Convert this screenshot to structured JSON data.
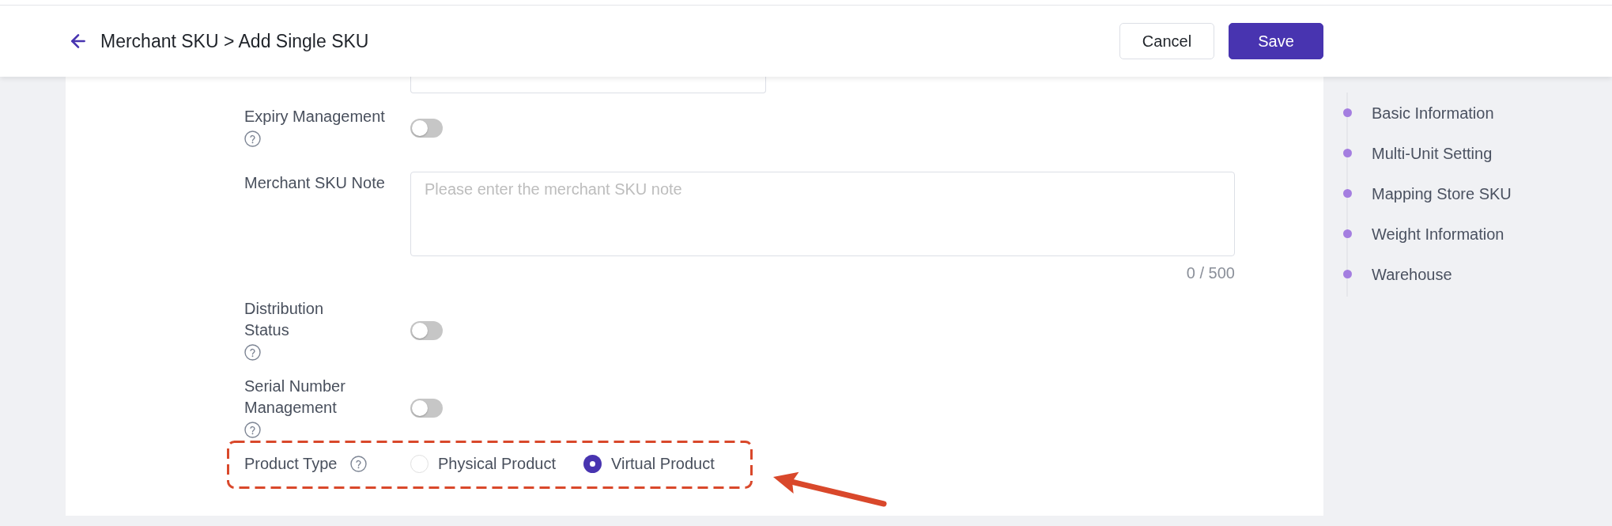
{
  "header": {
    "title": "Merchant SKU > Add Single SKU",
    "buttons": [
      {
        "label": "Cancel",
        "kind": "secondary"
      },
      {
        "label": "Save",
        "kind": "primary"
      }
    ]
  },
  "form": {
    "fields": [
      {
        "kind": "toggle",
        "label": "Expiry Management",
        "help": true,
        "on": false
      },
      {
        "kind": "textarea",
        "label": "Merchant SKU Note",
        "placeholder": "Please enter the merchant SKU note",
        "counter": "0 / 500"
      },
      {
        "kind": "toggle",
        "label": "Distribution\nStatus",
        "help": true,
        "on": false
      },
      {
        "kind": "toggle",
        "label": "Serial Number\nManagement",
        "help": true,
        "on": false
      },
      {
        "kind": "radio",
        "label": "Product Type",
        "help": true,
        "highlighted": true,
        "options": [
          {
            "label": "Physical Product",
            "selected": false
          },
          {
            "label": "Virtual Product",
            "selected": true
          }
        ]
      }
    ]
  },
  "section_nav": {
    "items": [
      "Basic Information",
      "Multi-Unit Setting",
      "Mapping Store SKU",
      "Weight Information",
      "Warehouse"
    ]
  }
}
